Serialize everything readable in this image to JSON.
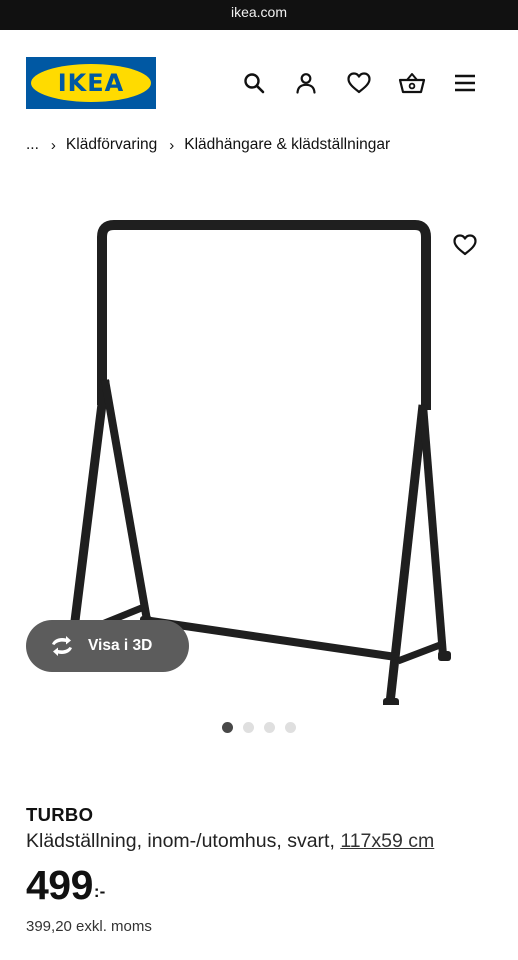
{
  "browser": {
    "url": "ikea.com"
  },
  "header": {
    "logo_text": "IKEA",
    "colors": {
      "logo_blue": "#0058a3",
      "logo_yellow": "#ffdb00"
    },
    "icons": [
      "search-icon",
      "user-icon",
      "heart-icon",
      "basket-icon",
      "menu-icon"
    ]
  },
  "breadcrumb": {
    "ellipsis": "...",
    "separator": "›",
    "items": [
      {
        "label": "Klädförvaring"
      },
      {
        "label": "Klädhängare & klädställningar"
      }
    ]
  },
  "gallery": {
    "view_3d_label": "Visa i 3D",
    "image_count": 4,
    "active_index": 0
  },
  "product": {
    "name": "TURBO",
    "description": "Klädställning, inom-/utomhus, svart, ",
    "size": "117x59 cm",
    "price": "499",
    "price_suffix": ":-",
    "price_excl": "399,20 exkl. moms"
  }
}
